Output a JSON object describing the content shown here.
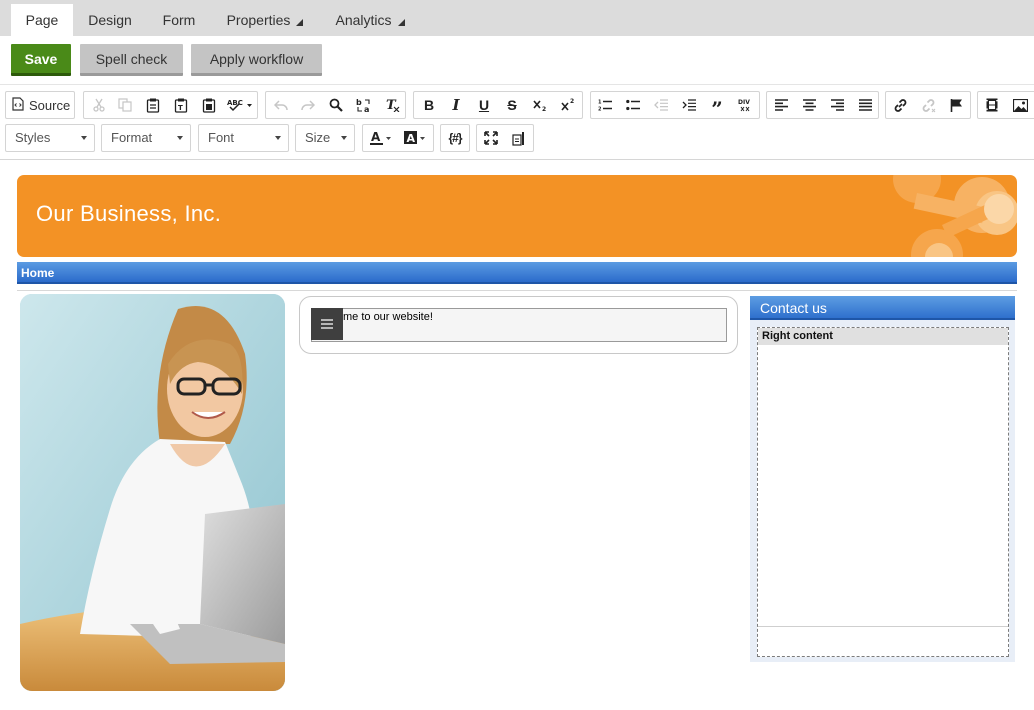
{
  "tabs": [
    {
      "label": "Page"
    },
    {
      "label": "Design"
    },
    {
      "label": "Form"
    },
    {
      "label": "Properties"
    },
    {
      "label": "Analytics"
    }
  ],
  "actions": {
    "save": "Save",
    "spell_check": "Spell check",
    "apply_workflow": "Apply workflow"
  },
  "toolbar": {
    "source": "Source",
    "styles": "Styles",
    "format": "Format",
    "font": "Font",
    "size": "Size"
  },
  "page": {
    "company": "Our Business, Inc.",
    "nav_home": "Home",
    "welcome_text": "me to our website!",
    "contact_title": "Contact us",
    "right_zone_label": "Right content"
  },
  "colors": {
    "save_green": "#4a8a18",
    "header_orange": "#f39225",
    "nav_blue": "#2b6bcb"
  }
}
